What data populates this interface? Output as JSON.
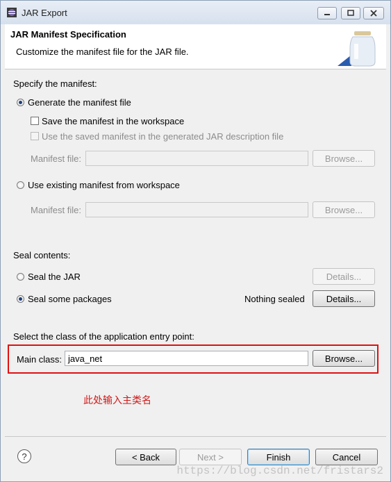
{
  "window": {
    "title": "JAR Export"
  },
  "header": {
    "title": "JAR Manifest Specification",
    "description": "Customize the manifest file for the JAR file."
  },
  "manifest": {
    "section_label": "Specify the manifest:",
    "generate_label": "Generate the manifest file",
    "save_label": "Save the manifest in the workspace",
    "use_saved_label": "Use the saved manifest in the generated JAR description file",
    "manifest_file_label": "Manifest file:",
    "browse_label": "Browse...",
    "use_existing_label": "Use existing manifest from workspace",
    "manifest_file_label2": "Manifest file:",
    "browse_label2": "Browse..."
  },
  "seal": {
    "section_label": "Seal contents:",
    "seal_jar_label": "Seal the JAR",
    "details_label": "Details...",
    "seal_some_label": "Seal some packages",
    "status": "Nothing sealed",
    "details_label2": "Details..."
  },
  "entry": {
    "section_label": "Select the class of the application entry point:",
    "main_class_label": "Main class:",
    "main_class_value": "java_net",
    "browse_label": "Browse..."
  },
  "annotation": "此处输入主类名",
  "footer": {
    "help": "?",
    "back": "< Back",
    "next": "Next >",
    "finish": "Finish",
    "cancel": "Cancel"
  },
  "watermark": "https://blog.csdn.net/fristars2",
  "colors": {
    "highlight": "#e01010",
    "annotation": "#d01818"
  }
}
